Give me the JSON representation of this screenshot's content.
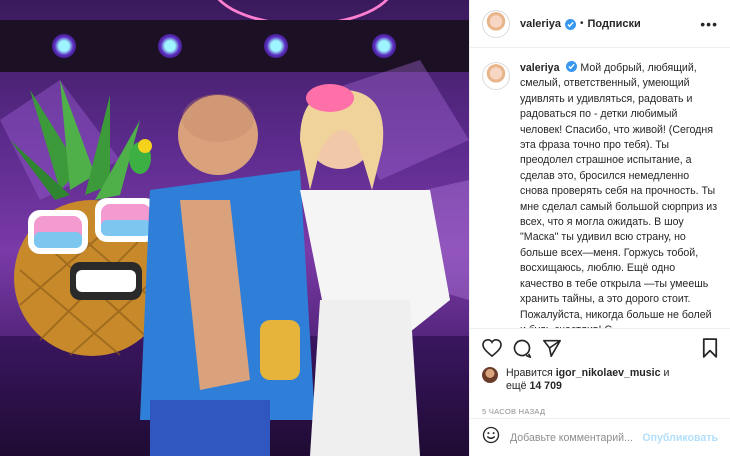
{
  "post": {
    "author": {
      "username": "valeriya",
      "verified": true,
      "follow_label": "Подписки",
      "separator": "•",
      "more_glyph": "•••"
    },
    "caption": {
      "username": "valeriya",
      "text": "Мой добрый, любящий, смелый, ответственный, умеющий удивлять и удивляться, радовать и радоваться по - детки любимый человек! Спасибо, что живой! (Сегодня эта фраза точно про тебя). Ты преодолел страшное испытание, а сделав это, бросился немедленно снова проверять себя на прочность. Ты мне сделал самый большой сюрприз из всех, что я могла ожидать. В шоу \"Маска\" ты удивил всю страну, но больше всех—меня. Горжусь тобой, восхищаюсь, люблю. Ещё одно качество в тебе открыла —ты умеешь хранить тайны, а это дорого стоит. Пожалуйста, никогда больше не болей и будь счастлив! С"
    },
    "actions": {
      "icons": [
        "heart-icon",
        "comment-icon",
        "share-icon",
        "bookmark-icon"
      ]
    },
    "likes": {
      "prefix": "Нравится",
      "user": "igor_nikolaev_music",
      "conj": "и",
      "more_prefix": "ещё",
      "count": "14 709"
    },
    "time_ago": "5 часов назад",
    "comment_box": {
      "placeholder": "Добавьте комментарий...",
      "publish_label": "Опубликовать",
      "emoji_icon": "smiley-icon"
    },
    "colors": {
      "text": "#262626",
      "secondary": "#8e8e8e",
      "verified": "#3897f0",
      "publish_disabled": "#b2dffc",
      "border": "#efefef"
    }
  }
}
